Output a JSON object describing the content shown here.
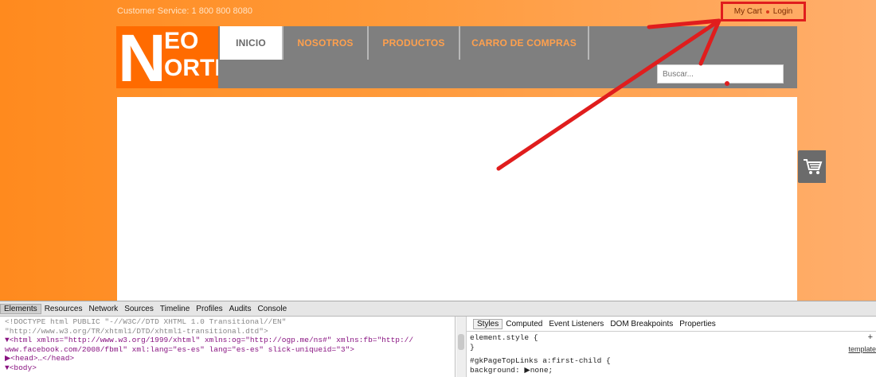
{
  "topbar": {
    "customer_service": "Customer Service: 1 800 800 8080",
    "my_cart": "My Cart",
    "login": "Login"
  },
  "logo": {
    "n": "N",
    "top": "EO",
    "bottom": "ORTE"
  },
  "nav": {
    "items": [
      {
        "label": "INICIO"
      },
      {
        "label": "NOSOTROS"
      },
      {
        "label": "PRODUCTOS"
      },
      {
        "label": "CARRO DE COMPRAS"
      }
    ]
  },
  "search": {
    "placeholder": "Buscar..."
  },
  "devtools": {
    "tabs": [
      "Elements",
      "Resources",
      "Network",
      "Sources",
      "Timeline",
      "Profiles",
      "Audits",
      "Console"
    ],
    "code_lines": [
      "<!DOCTYPE html PUBLIC \"-//W3C//DTD XHTML 1.0 Transitional//EN\"",
      "\"http://www.w3.org/TR/xhtml1/DTD/xhtml1-transitional.dtd\">",
      "▼<html xmlns=\"http://www.w3.org/1999/xhtml\" xmlns:og=\"http://ogp.me/ns#\" xmlns:fb=\"http://",
      "www.facebook.com/2008/fbml\" xml:lang=\"es-es\" lang=\"es-es\" slick-uniqueid=\"3\">",
      "▶<head>…</head>",
      "▼<body>"
    ],
    "side_tabs": [
      "Styles",
      "Computed",
      "Event Listeners",
      "DOM Breakpoints",
      "Properties"
    ],
    "styles_lines": [
      "element.style {",
      "}",
      "#gkPageTopLinks a:first-child {",
      "  background: ▶none;"
    ],
    "templates_link": "template",
    "plus": "+"
  },
  "colors": {
    "brand_orange": "#ff6b00",
    "header_gray": "#7f7f7f",
    "annotation_red": "#e01d1d"
  }
}
